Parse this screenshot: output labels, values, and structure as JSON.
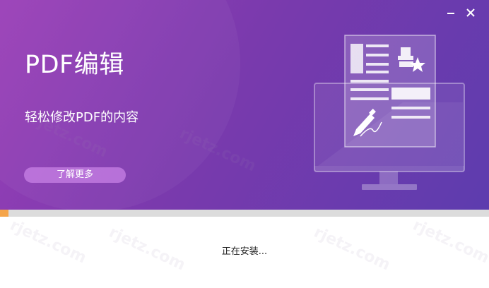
{
  "window": {
    "minimize_label": "—",
    "close_label": "✕"
  },
  "banner": {
    "title": "PDF编辑",
    "subtitle": "轻松修改PDF的内容",
    "learn_more_label": "了解更多"
  },
  "install": {
    "progress_fraction": 0.018,
    "status_text": "正在安装..."
  },
  "colors": {
    "banner_start": "#9a3fb8",
    "banner_end": "#5d3cae",
    "progress_fill": "#f5a54a",
    "progress_track": "#dcdcdc"
  },
  "icons": {
    "minimize": "minimize-icon",
    "close": "close-icon",
    "illustration": "pdf-edit-illustration"
  }
}
